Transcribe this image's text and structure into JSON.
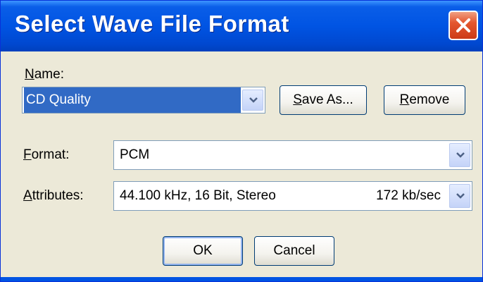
{
  "window": {
    "title": "Select Wave File Format",
    "close_icon": "close-icon"
  },
  "name_field": {
    "label_prefix": "",
    "label_accel": "N",
    "label_rest": "ame:",
    "value": "CD Quality"
  },
  "buttons": {
    "save_as_accel": "S",
    "save_as_rest": "ave As...",
    "remove_accel": "R",
    "remove_rest": "emove",
    "ok": "OK",
    "cancel": "Cancel"
  },
  "format_field": {
    "label_accel": "F",
    "label_rest": "ormat:",
    "value": "PCM"
  },
  "attributes_field": {
    "label_accel": "A",
    "label_rest": "ttributes:",
    "value": "44.100 kHz, 16 Bit, Stereo",
    "bitrate": "172 kb/sec"
  },
  "colors": {
    "title_bar": "#0054e3",
    "dialog_bg": "#ece9d8",
    "selection": "#316ac5",
    "close_button": "#e4572f"
  }
}
